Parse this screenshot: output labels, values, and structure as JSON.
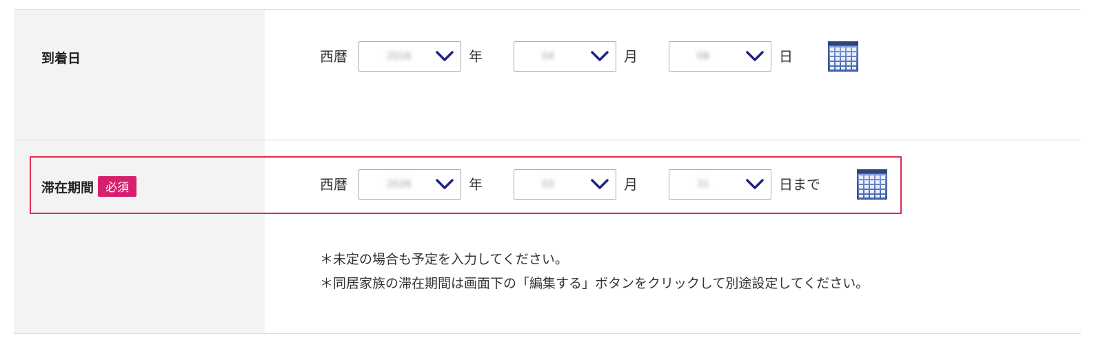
{
  "arrival": {
    "label": "到着日",
    "era": "西暦",
    "year": {
      "value": "2016"
    },
    "year_unit": "年",
    "month": {
      "value": "04"
    },
    "month_unit": "月",
    "day": {
      "value": "08"
    },
    "day_unit": "日"
  },
  "stay": {
    "label": "滞在期間",
    "required_badge": "必須",
    "era": "西暦",
    "year": {
      "value": "2026"
    },
    "year_unit": "年",
    "month": {
      "value": "03"
    },
    "month_unit": "月",
    "day": {
      "value": "31"
    },
    "day_unit": "日まで",
    "notes": [
      "＊未定の場合も予定を入力してください。",
      "＊同居家族の滞在期間は画面下の「編集する」ボタンをクリックして別途設定してください。"
    ]
  },
  "colors": {
    "label_bg": "#f3f3f3",
    "badge": "#d6206f",
    "highlight_border": "#e0284f",
    "chevron": "#1a237e"
  },
  "icons": {
    "select_arrow": "chevron-down-icon",
    "calendar": "calendar-icon"
  }
}
